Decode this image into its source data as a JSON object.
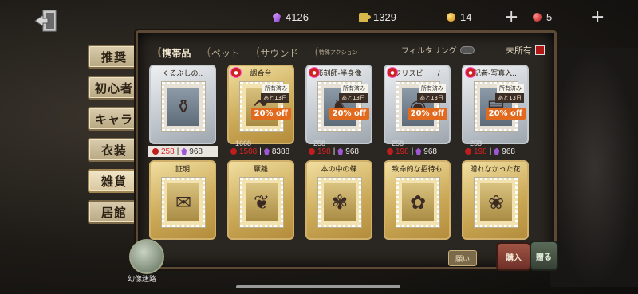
{
  "topbar": {
    "currencies": [
      {
        "icon": "gem-icon",
        "value": "4126"
      },
      {
        "icon": "puzzle-icon",
        "value": "1329"
      },
      {
        "icon": "coin-icon",
        "value": "14"
      },
      {
        "icon": "ruby-icon",
        "value": "5"
      }
    ]
  },
  "nav": {
    "items": [
      {
        "label": "推奨"
      },
      {
        "label": "初心者"
      },
      {
        "label": "キャラ"
      },
      {
        "label": "衣装"
      },
      {
        "label": "雑貨"
      },
      {
        "label": "居館"
      }
    ],
    "active_index": 4
  },
  "tabs": {
    "items": [
      {
        "label": "携帯品"
      },
      {
        "label": "ペット"
      },
      {
        "label": "サウンド"
      },
      {
        "label": "特殊アクション"
      }
    ],
    "filter_label": "フィルタリング",
    "unowned_label": "未所有"
  },
  "cards": [
    {
      "name": "くるぶしの..",
      "style": "silver",
      "icon": "gem-pendant-icon",
      "price_red": "258",
      "price_purple": "968",
      "price_bar": true
    },
    {
      "name": "調合台",
      "style": "gold",
      "icon": "alchemy-table-icon",
      "owned": "所有済み",
      "remain": "あと13日",
      "discount": "20% off",
      "orig": "1668",
      "price_red": "1508",
      "price_purple": "8388",
      "price_bar": false
    },
    {
      "name": "彫刻師-半身像",
      "style": "silver",
      "icon": "bust-icon",
      "owned": "所有済み",
      "remain": "あと13日",
      "discount": "20% off",
      "orig": "258",
      "price_red": "198",
      "price_purple": "968",
      "price_bar": false
    },
    {
      "name": "フリスビー　/",
      "style": "silver",
      "icon": "frisbee-icon",
      "owned": "所有済み",
      "remain": "あと13日",
      "discount": "20% off",
      "orig": "258",
      "price_red": "198",
      "price_purple": "968",
      "price_bar": false
    },
    {
      "name": "記者-写真入..",
      "style": "silver",
      "icon": "photo-album-icon",
      "owned": "所有済み",
      "remain": "あと13日",
      "discount": "20% off",
      "orig": "258",
      "price_red": "198",
      "price_purple": "968",
      "price_bar": false
    },
    {
      "name": "証明",
      "style": "gold",
      "icon": "certificate-icon"
    },
    {
      "name": "厭離",
      "style": "gold",
      "icon": "wing-icon"
    },
    {
      "name": "本の中の蝶",
      "style": "gold",
      "icon": "butterfly-book-icon"
    },
    {
      "name": "致命的な招待も",
      "style": "gold",
      "icon": "invitation-icon"
    },
    {
      "name": "贈れなかった花",
      "style": "gold",
      "icon": "bouquet-icon"
    }
  ],
  "bottom": {
    "maze_label": "幻像迷路",
    "wish_label": "願い",
    "buy_label": "購入",
    "gift_label": "贈る"
  }
}
